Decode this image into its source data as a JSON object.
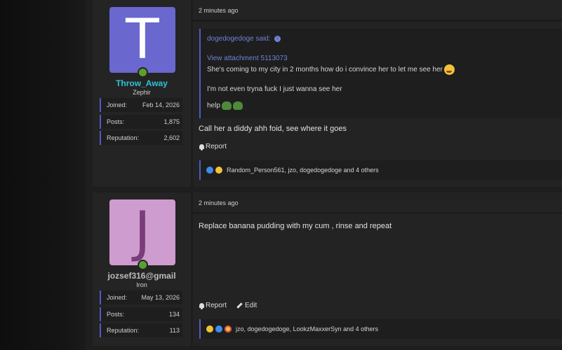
{
  "posts": [
    {
      "timestamp": "2 minutes ago",
      "author": {
        "avatar_letter": "T",
        "username": "Throw_Away",
        "user_title": "Zephir",
        "online": true,
        "stats": [
          {
            "label": "Joined:",
            "value": "Feb 14, 2026"
          },
          {
            "label": "Posts:",
            "value": "1,875"
          },
          {
            "label": "Reputation:",
            "value": "2,602"
          }
        ]
      },
      "quote": {
        "author_line": "dogedogedoge said:",
        "attachment_link": "View attachment 5113073",
        "lines": [
          "She's coming to my city in 2 months how do i convince her to let me see her",
          "I'm not even tryna fuck I just wanna see her",
          "help"
        ],
        "emojis": [
          "crying-face",
          "pepe",
          "pepe"
        ]
      },
      "body": "Call her a diddy ahh foid, see where it goes",
      "actions": {
        "report": "Report"
      },
      "reactions": {
        "icons": [
          "like",
          "laugh"
        ],
        "text": "Random_Person561, jzo, dogedogedoge and 4 others"
      },
      "colors": {
        "avatar_bg": "#6a67cf",
        "username": "#2ec4d6"
      }
    },
    {
      "timestamp": "2 minutes ago",
      "author": {
        "avatar_letter": "J",
        "username": "jozsef316@gmail",
        "user_title": "Iron",
        "online": true,
        "stats": [
          {
            "label": "Joined:",
            "value": "May 13, 2026"
          },
          {
            "label": "Posts:",
            "value": "134"
          },
          {
            "label": "Reputation:",
            "value": "113"
          }
        ]
      },
      "body": "Replace banana pudding with my cum , rinse and repeat",
      "actions": {
        "report": "Report",
        "edit": "Edit"
      },
      "reactions": {
        "icons": [
          "laugh",
          "like",
          "love"
        ],
        "text": "jzo, dogedogedoge, LookzMaxxerSyn and 4 others"
      },
      "colors": {
        "avatar_bg": "#cf9ccf",
        "username": "#bdbdbd"
      }
    }
  ]
}
